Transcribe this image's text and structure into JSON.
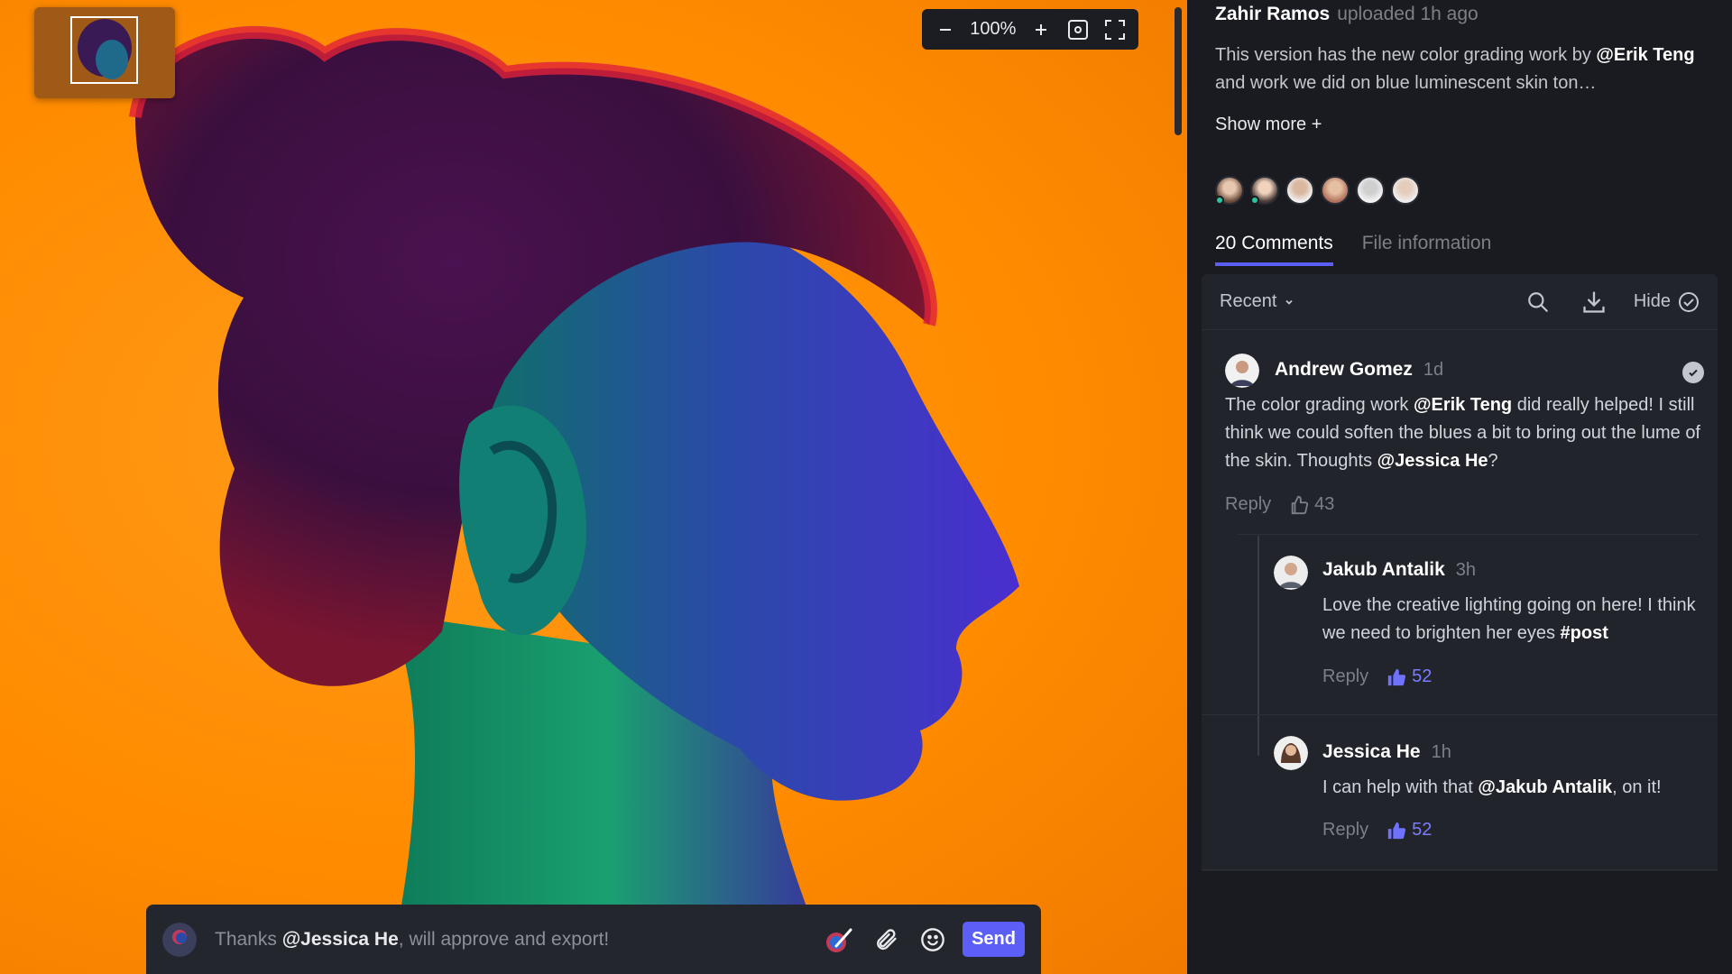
{
  "viewer": {
    "zoom": "100%"
  },
  "composer": {
    "mention": "@Jessica He",
    "prefix": "Thanks ",
    "suffix": ", will approve and export!",
    "send_label": "Send"
  },
  "upload": {
    "user": "Zahir Ramos",
    "when": "uploaded 1h ago",
    "description_before": "This version has the new color grading work by ",
    "description_mention": "@Erik Teng",
    "description_after": " and work we did on blue luminescent skin ton…",
    "show_more": "Show more +"
  },
  "tabs": [
    {
      "label": "20 Comments",
      "active": true
    },
    {
      "label": "File information",
      "active": false
    }
  ],
  "toolbar": {
    "sort": "Recent",
    "hide_label": "Hide"
  },
  "comments": [
    {
      "author": "Andrew Gomez",
      "ago": "1d",
      "text_parts": [
        "The color grading work ",
        "@Erik Teng",
        " did really helped! I still think we could soften the blues a bit to bring out the lume of the skin. Thoughts ",
        "@Jessica He",
        "?"
      ],
      "reply_label": "Reply",
      "likes": "43"
    },
    {
      "author": "Jakub Antalik",
      "ago": "3h",
      "text_parts": [
        "Love the creative lighting going on here! I think we need to brighten her eyes ",
        "#post"
      ],
      "reply_label": "Reply",
      "likes": "52"
    },
    {
      "author": "Jessica He",
      "ago": "1h",
      "text_parts": [
        "I can help with that ",
        "@Jakub Antalik",
        ", on it!"
      ],
      "reply_label": "Reply",
      "likes": "52"
    }
  ],
  "colors": {
    "accent": "#5b5ff5",
    "background_orange": "#ff8c00",
    "panel": "#1a1b20"
  }
}
